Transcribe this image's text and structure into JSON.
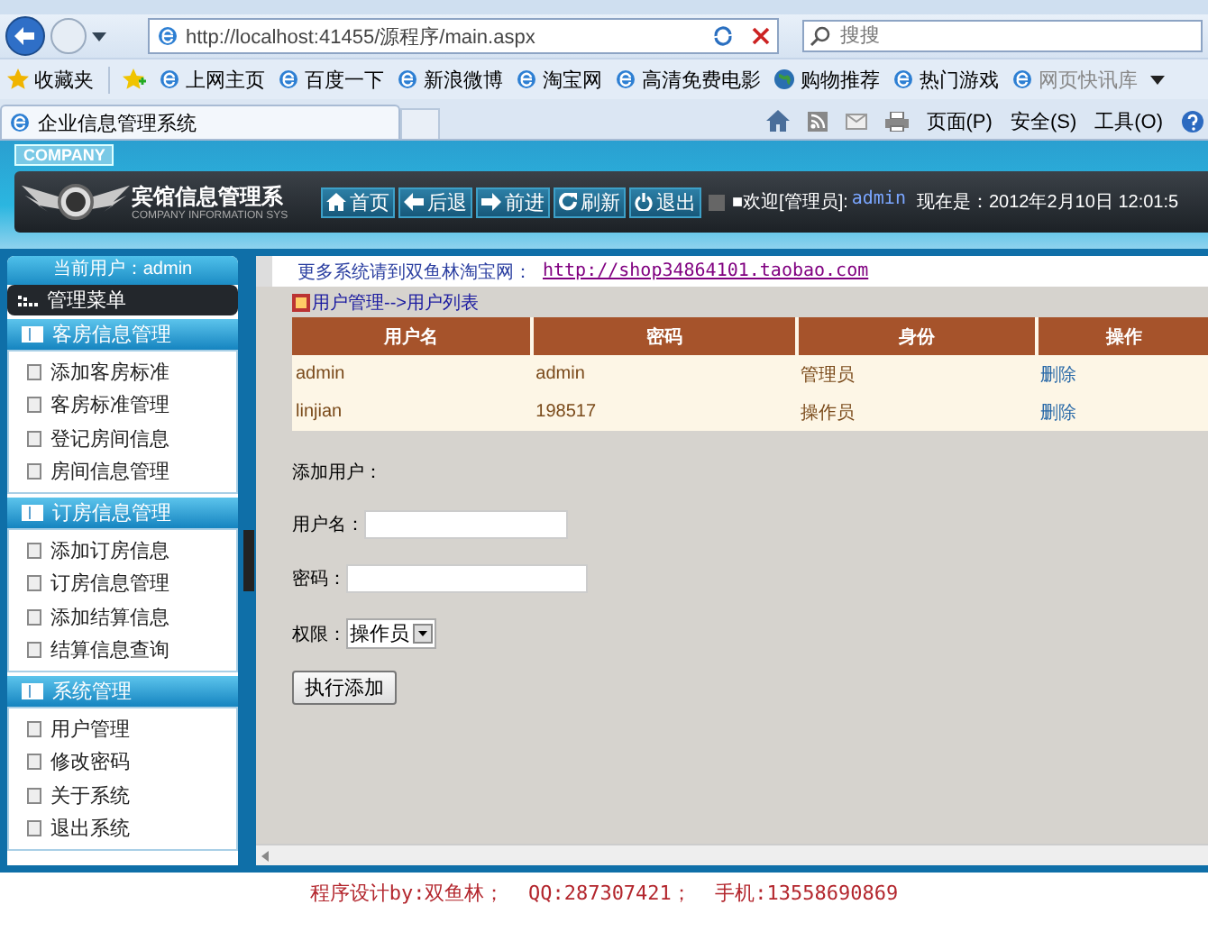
{
  "browser": {
    "address": "http://localhost:41455/源程序/main.aspx",
    "search_placeholder": "搜搜",
    "favorites_label": "收藏夹",
    "favorites": [
      {
        "label": "上网主页",
        "kind": "page"
      },
      {
        "label": "百度一下",
        "kind": "page"
      },
      {
        "label": "新浪微博",
        "kind": "page"
      },
      {
        "label": "淘宝网",
        "kind": "page"
      },
      {
        "label": "高清免费电影",
        "kind": "page"
      },
      {
        "label": "购物推荐",
        "kind": "globe"
      },
      {
        "label": "热门游戏",
        "kind": "page"
      },
      {
        "label": "网页快讯库",
        "kind": "feed"
      }
    ],
    "tab_title": "企业信息管理系统",
    "tools": [
      "页面(P)",
      "安全(S)",
      "工具(O)"
    ]
  },
  "header": {
    "badge": "COMPANY",
    "title": "宾馆信息管理系",
    "subtitle": "COMPANY INFORMATION SYS",
    "nav": [
      {
        "label": "首页",
        "kind": "home"
      },
      {
        "label": "后退",
        "kind": "back"
      },
      {
        "label": "前进",
        "kind": "forward"
      },
      {
        "label": "刷新",
        "kind": "refresh"
      },
      {
        "label": "退出",
        "kind": "exit"
      }
    ],
    "welcome": "■欢迎[管理员]:",
    "user": "admin",
    "time": "现在是：2012年2月10日 12:01:5"
  },
  "sidebar": {
    "current_user": "当前用户：admin",
    "menu_title": "管理菜单",
    "groups": [
      {
        "title": "客房信息管理",
        "items": [
          "添加客房标准",
          "客房标准管理",
          "登记房间信息",
          "房间信息管理"
        ]
      },
      {
        "title": "订房信息管理",
        "items": [
          "添加订房信息",
          "订房信息管理",
          "添加结算信息",
          "结算信息查询"
        ]
      },
      {
        "title": "系统管理",
        "items": [
          "用户管理",
          "修改密码",
          "关于系统",
          "退出系统"
        ]
      }
    ]
  },
  "content": {
    "notice": "更多系统请到双鱼林淘宝网：",
    "notice_link": "http://shop34864101.taobao.com",
    "breadcrumb": "用户管理-->用户列表",
    "table": {
      "columns": [
        "用户名",
        "密码",
        "身份",
        "操作"
      ],
      "rows": [
        {
          "cells": [
            "admin",
            "admin",
            "管理员"
          ],
          "action": "删除"
        },
        {
          "cells": [
            "linjian",
            "198517",
            "操作员"
          ],
          "action": "删除"
        }
      ]
    },
    "form": {
      "heading": "添加用户：",
      "fields": [
        {
          "kind": "text",
          "label": "用户名："
        },
        {
          "kind": "password",
          "label": "密码："
        },
        {
          "kind": "select",
          "label": "权限：",
          "value": "操作员"
        }
      ],
      "submit": "执行添加"
    }
  },
  "footer": "程序设计by:双鱼林；  QQ:287307421；  手机:13558690869"
}
